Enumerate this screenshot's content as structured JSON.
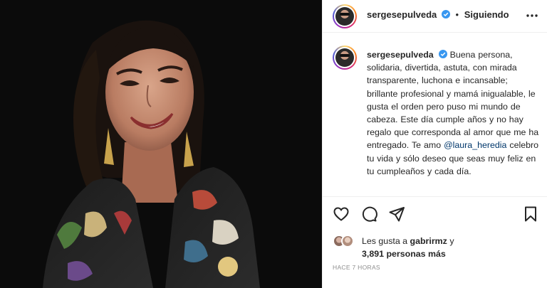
{
  "post": {
    "username": "sergesepulveda",
    "follow_status": "Siguiendo",
    "caption_body": "Buena persona, solidaria, divertida, astuta, con mirada transparente, luchona e incansable; brillante profesional y mamá inigualable, le gusta el orden pero puso mi mundo de cabeza. Este día cumple años y no hay regalo que corresponda al amor que me ha entregado. Te amo",
    "mention": "@laura_heredia",
    "caption_end": "celebro tu vida y sólo deseo que seas muy feliz en tu cumpleaños y cada día.",
    "likes_prefix": "Les gusta a",
    "likes_user": "gabrirmz",
    "likes_joiner": "y",
    "likes_count": "3,891 personas más",
    "time_ago": "HACE 7 HORAS"
  },
  "icons": {
    "verified": "verified-badge-icon",
    "more": "more-options-icon",
    "like": "heart-icon",
    "comment": "comment-icon",
    "share": "paper-plane-icon",
    "save": "bookmark-icon"
  },
  "colors": {
    "verified_blue": "#3897f0",
    "mention": "#00376b",
    "muted": "#8e8e8e",
    "photo_bg": "#0b0b0b"
  }
}
